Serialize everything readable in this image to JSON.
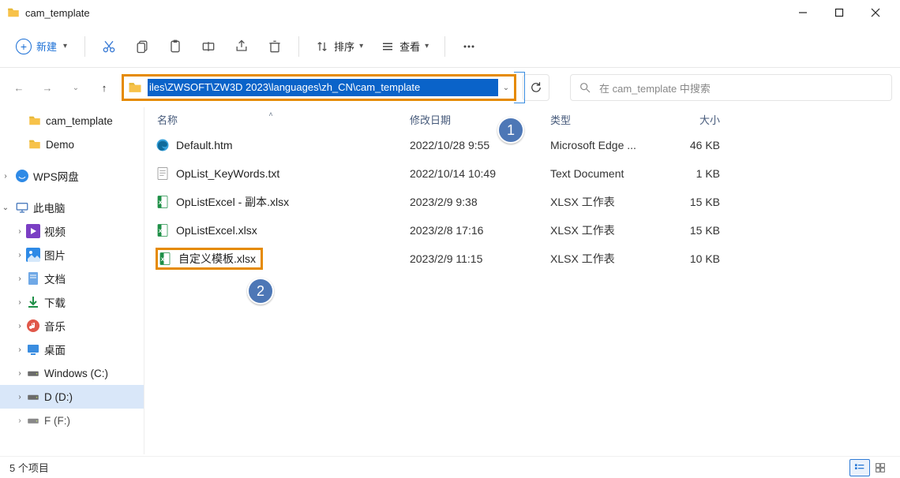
{
  "window": {
    "title": "cam_template"
  },
  "toolbar": {
    "new_label": "新建",
    "sort_label": "排序",
    "view_label": "查看"
  },
  "nav": {
    "path": "iles\\ZWSOFT\\ZW3D 2023\\languages\\zh_CN\\cam_template",
    "search_placeholder": "在 cam_template 中搜索"
  },
  "callouts": {
    "one": "1",
    "two": "2"
  },
  "columns": {
    "name": "名称",
    "date": "修改日期",
    "type": "类型",
    "size": "大小"
  },
  "sidebar": {
    "cam_template": "cam_template",
    "demo": "Demo",
    "wps": "WPS网盘",
    "this_pc": "此电脑",
    "videos": "视频",
    "pictures": "图片",
    "documents": "文档",
    "downloads": "下载",
    "music": "音乐",
    "desktop": "桌面",
    "c_drive": "Windows (C:)",
    "d_drive": "D (D:)",
    "e_drive": "F (F:)"
  },
  "files": [
    {
      "name": "Default.htm",
      "date": "2022/10/28 9:55",
      "type": "Microsoft Edge ...",
      "size": "46 KB",
      "icon": "edge"
    },
    {
      "name": "OpList_KeyWords.txt",
      "date": "2022/10/14 10:49",
      "type": "Text Document",
      "size": "1 KB",
      "icon": "txt"
    },
    {
      "name": "OpListExcel - 副本.xlsx",
      "date": "2023/2/9 9:38",
      "type": "XLSX 工作表",
      "size": "15 KB",
      "icon": "xlsx"
    },
    {
      "name": "OpListExcel.xlsx",
      "date": "2023/2/8 17:16",
      "type": "XLSX 工作表",
      "size": "15 KB",
      "icon": "xlsx"
    },
    {
      "name": "自定义模板.xlsx",
      "date": "2023/2/9 11:15",
      "type": "XLSX 工作表",
      "size": "10 KB",
      "icon": "xlsx",
      "highlight": true
    }
  ],
  "status": {
    "count": "5 个项目"
  }
}
